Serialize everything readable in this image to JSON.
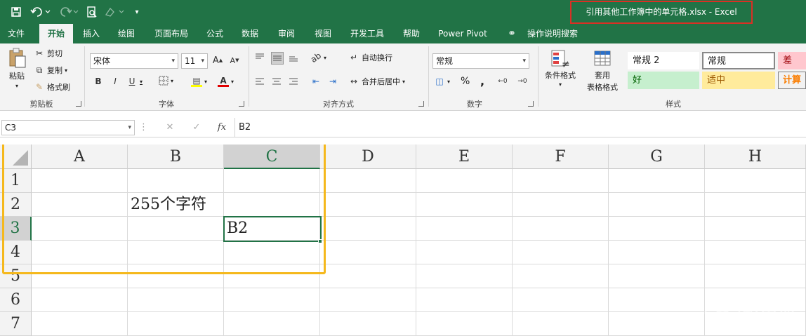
{
  "window": {
    "title": "引用其他工作簿中的单元格.xlsx  -  Excel"
  },
  "quick_access": {
    "save_icon": "save-icon",
    "undo_icon": "undo-icon",
    "redo_icon": "redo-icon",
    "preview_icon": "print-preview-icon",
    "customize_icon": "customize-icon"
  },
  "tabs": [
    "文件",
    "开始",
    "插入",
    "绘图",
    "页面布局",
    "公式",
    "数据",
    "审阅",
    "视图",
    "开发工具",
    "帮助",
    "Power Pivot",
    "操作说明搜索"
  ],
  "active_tab": "开始",
  "clipboard": {
    "paste": "粘贴",
    "cut": "剪切",
    "copy": "复制",
    "format_painter": "格式刷",
    "group": "剪贴板"
  },
  "font": {
    "name": "宋体",
    "size": "11",
    "bold": "B",
    "italic": "I",
    "underline": "U",
    "group": "字体"
  },
  "alignment": {
    "wrap": "自动换行",
    "merge": "合并后居中",
    "group": "对齐方式"
  },
  "number": {
    "format": "常规",
    "percent": "%",
    "comma": ",",
    "group": "数字"
  },
  "styles": {
    "conditional": "条件格式",
    "table_line1": "套用",
    "table_line2": "表格格式",
    "cells": [
      "常规 2",
      "常规",
      "差",
      "好",
      "适中",
      "计算"
    ],
    "group": "样式"
  },
  "formula_bar": {
    "name_box": "C3",
    "fx": "fx",
    "value": "B2"
  },
  "columns": [
    "A",
    "B",
    "C",
    "D",
    "E",
    "F",
    "G",
    "H"
  ],
  "rows": [
    "1",
    "2",
    "3",
    "4",
    "5",
    "6",
    "7"
  ],
  "cells": {
    "B2": "255个字符",
    "C3": "B2"
  },
  "selected_cell": "C3",
  "colors": {
    "excel_green": "#217346",
    "highlight_box": "#f5b81c",
    "title_box": "#d93025"
  },
  "watermark": {
    "name": "路由器",
    "url": "luyouqi.com"
  }
}
